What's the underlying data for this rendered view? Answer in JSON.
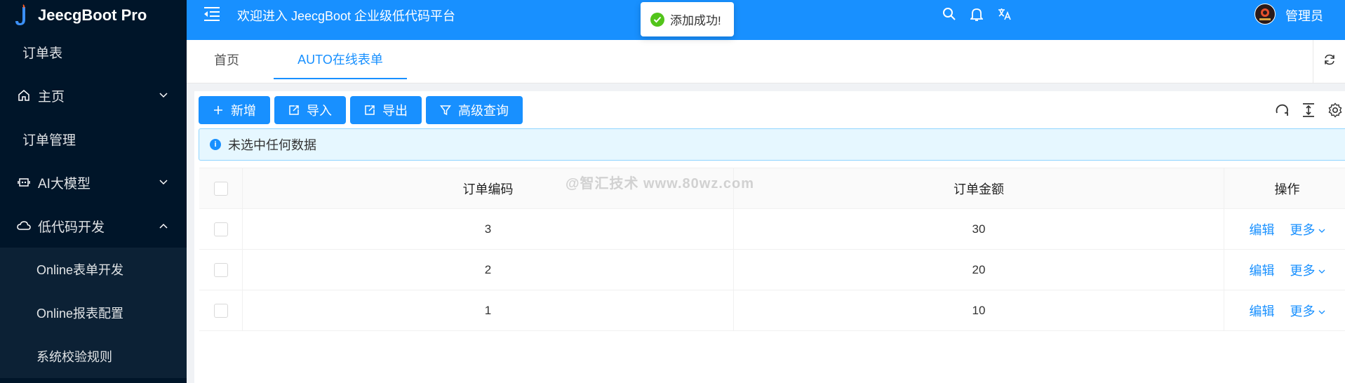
{
  "app": {
    "title": "JeecgBoot Pro"
  },
  "sidebar": {
    "items": [
      {
        "label": "订单表"
      },
      {
        "label": "主页",
        "icon": "home-icon"
      },
      {
        "label": "订单管理"
      },
      {
        "label": "AI大模型",
        "icon": "robot-icon"
      },
      {
        "label": "低代码开发",
        "icon": "cloud-icon"
      }
    ],
    "submenu": [
      {
        "label": "Online表单开发"
      },
      {
        "label": "Online报表配置"
      },
      {
        "label": "系统校验规则"
      }
    ]
  },
  "header": {
    "welcome": "欢迎进入 JeecgBoot 企业级低代码平台",
    "username": "管理员"
  },
  "toast": {
    "message": "添加成功!"
  },
  "tabs": [
    {
      "label": "首页"
    },
    {
      "label": "AUTO在线表单"
    }
  ],
  "toolbar": {
    "add_label": "新增",
    "import_label": "导入",
    "export_label": "导出",
    "advanced_query_label": "高级查询"
  },
  "alert": {
    "text": "未选中任何数据"
  },
  "table": {
    "columns": [
      "订单编码",
      "订单金额",
      "操作"
    ],
    "rows": [
      {
        "code": "3",
        "amount": "30"
      },
      {
        "code": "2",
        "amount": "20"
      },
      {
        "code": "1",
        "amount": "10"
      }
    ],
    "edit_label": "编辑",
    "more_label": "更多"
  },
  "watermark": "@智汇技术 www.80wz.com",
  "colors": {
    "primary": "#1890ff",
    "sidebar": "#001529",
    "success": "#52c41a"
  }
}
